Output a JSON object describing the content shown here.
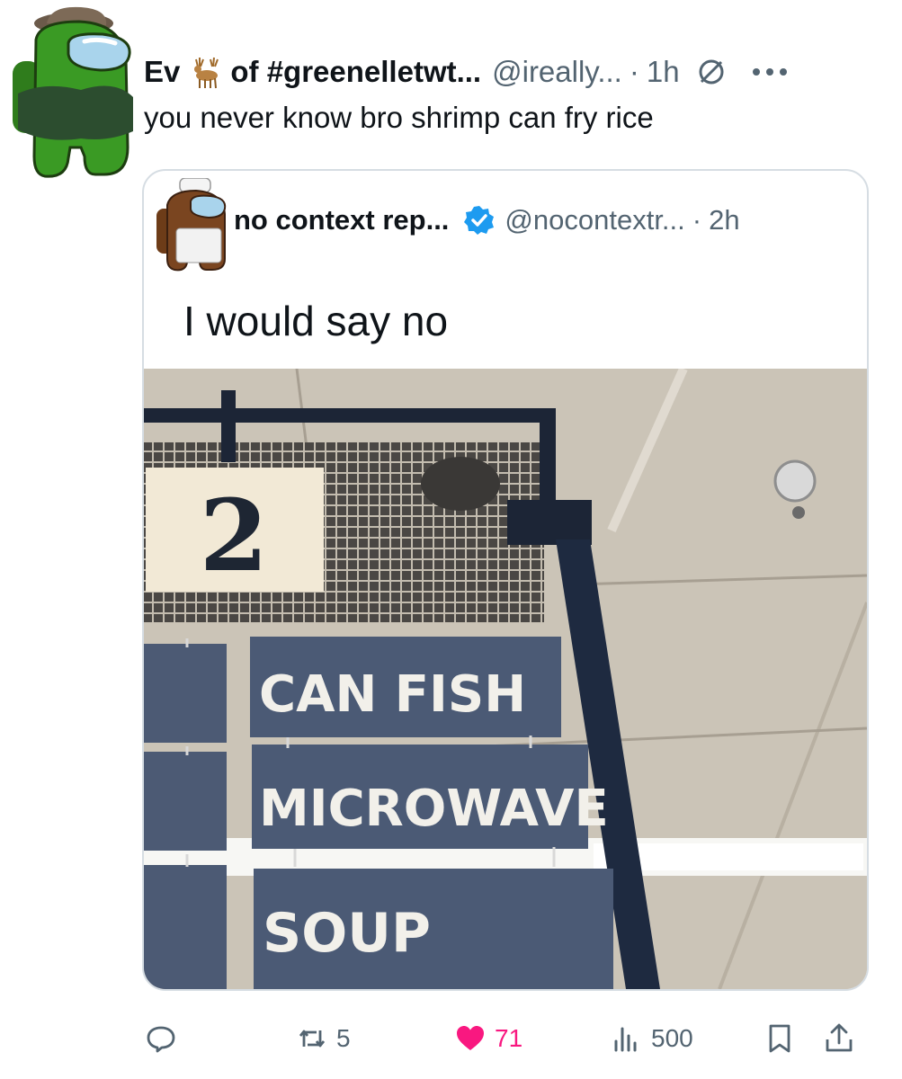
{
  "tweet": {
    "author_name_start": "Ev",
    "author_name_end": "of #greenelletwt...",
    "handle": "@ireally...",
    "time": "1h",
    "text": "you never know bro shrimp can fry rice",
    "avatar_icon": "green-crewmate-icon",
    "name_emoji_icon": "deer-icon",
    "muted_icon": "muted-icon",
    "more_icon": "more-icon"
  },
  "quote": {
    "author_name": "no context rep...",
    "verified_icon": "verified-badge-icon",
    "handle": "@nocontextr...",
    "time": "2h",
    "text": "I would say no",
    "avatar_icon": "brown-crewmate-chef-icon",
    "image": {
      "aisle_number": "2",
      "signs": [
        "CAN FISH",
        "MICROWAVE",
        "SOUP"
      ]
    }
  },
  "actions": {
    "reply_icon": "reply-icon",
    "retweet_icon": "retweet-icon",
    "retweet_count": "5",
    "like_icon": "heart-icon",
    "like_count": "71",
    "views_icon": "views-icon",
    "views_count": "500",
    "bookmark_icon": "bookmark-icon",
    "share_icon": "share-icon"
  },
  "colors": {
    "text_primary": "#0f1419",
    "text_secondary": "#536471",
    "like": "#f91880",
    "verified": "#1d9bf0",
    "sign": "#4b5a75",
    "avatar_green": "#3a9a24",
    "avatar_brown": "#7a4520"
  }
}
